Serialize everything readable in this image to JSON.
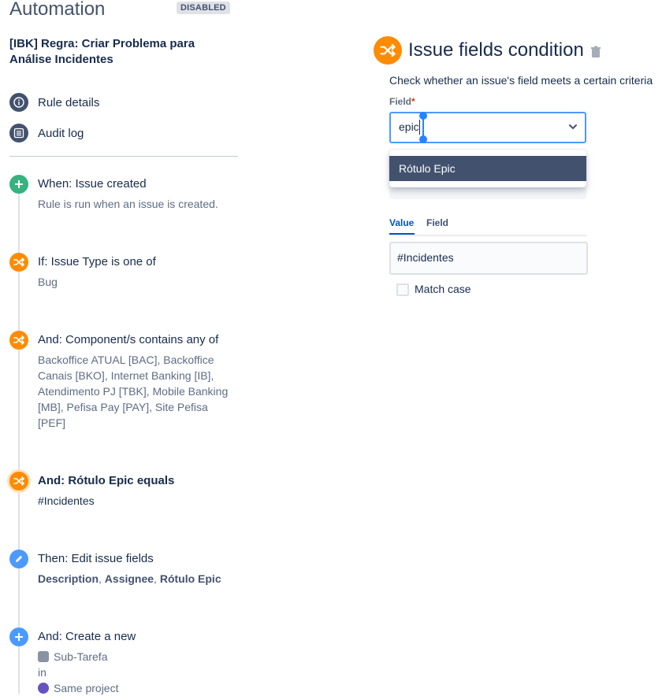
{
  "header": {
    "title": "Automation",
    "badge": "DISABLED",
    "rule_name": "[IBK] Regra: Criar Problema para Análise Incidentes"
  },
  "side_links": [
    {
      "label": "Rule details",
      "icon": "info-icon"
    },
    {
      "label": "Audit log",
      "icon": "list-icon"
    }
  ],
  "steps": [
    {
      "title": "When: Issue created",
      "desc": "Rule is run when an issue is created.",
      "icon": "plus-icon",
      "color": "#36b37e"
    },
    {
      "title": "If: Issue Type is one of",
      "desc": "Bug",
      "icon": "shuffle-icon",
      "color": "#ff8b00"
    },
    {
      "title": "And: Component/s contains any of",
      "desc": "Backoffice ATUAL [BAC], Backoffice Canais [BKO], Internet Banking [IB], Atendimento PJ [TBK], Mobile Banking [MB], Pefisa Pay [PAY], Site Pefisa [PEF]",
      "icon": "shuffle-icon",
      "color": "#ff8b00"
    },
    {
      "title": "And: Rótulo Epic equals",
      "desc": "#Incidentes",
      "icon": "shuffle-icon",
      "color": "#ff8b00"
    },
    {
      "title": "Then: Edit issue fields",
      "desc_parts": [
        "Description",
        ", ",
        "Assignee",
        ", ",
        "Rótulo Epic"
      ],
      "icon": "pencil-icon",
      "color": "#4c9aff"
    },
    {
      "title": "And: Create a new",
      "lines": [
        "Sub-Tarefa",
        "in",
        "Same project"
      ],
      "icon": "plus-icon",
      "color": "#4c9aff"
    }
  ],
  "panel": {
    "title": "Issue fields condition",
    "description": "Check whether an issue's field meets a certain criteria",
    "field_label": "Field",
    "required_mark": "*",
    "field_value": "epic",
    "dropdown_option": "Rótulo Epic",
    "tabs": [
      "Value",
      "Field"
    ],
    "value": "#Incidentes",
    "match_case_label": "Match case",
    "match_case_checked": false
  },
  "colors": {
    "accent": "#0052cc",
    "condition": "#ff8b00",
    "trigger": "#36b37e",
    "action": "#4c9aff"
  }
}
